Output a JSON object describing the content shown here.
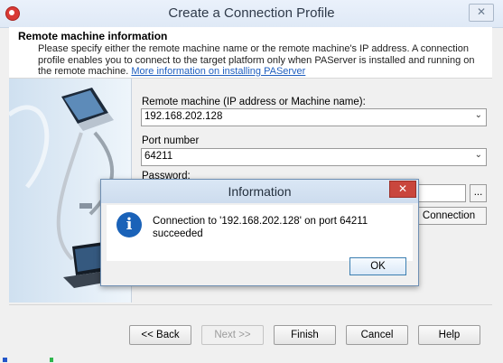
{
  "window": {
    "title": "Create a Connection Profile",
    "close_glyph": "✕"
  },
  "header": {
    "title": "Remote machine information",
    "description": "Please specify either the remote machine name or the remote machine's IP address. A connection profile enables you to connect to the target platform only when PAServer is installed and running on the remote machine.",
    "link_text": "More information on installing PAServer"
  },
  "form": {
    "remote_machine_label": "Remote machine (IP address or Machine name):",
    "remote_machine_value": "192.168.202.128",
    "port_label": "Port number",
    "port_value": "64211",
    "password_label": "Password:",
    "browse_label": "...",
    "test_connection_label": "Connection"
  },
  "footer": {
    "back": "<< Back",
    "next": "Next >>",
    "finish": "Finish",
    "cancel": "Cancel",
    "help": "Help"
  },
  "dialog": {
    "title": "Information",
    "close_glyph": "✕",
    "icon_glyph": "i",
    "message": "Connection to '192.168.202.128' on port 64211 succeeded",
    "ok": "OK"
  },
  "colors": {
    "info_blue": "#1a62b8",
    "link_blue": "#1f5fbf",
    "dialog_close_red": "#c9463d"
  },
  "icons": [
    "app-icon",
    "computer-icon",
    "laptop-icon",
    "info-icon",
    "chevron-down-icon",
    "close-icon"
  ]
}
